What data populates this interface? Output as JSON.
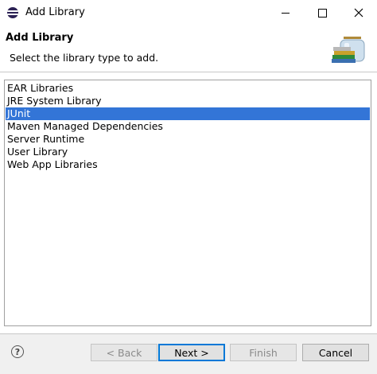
{
  "window": {
    "title": "Add Library"
  },
  "header": {
    "title": "Add Library",
    "description": "Select the library type to add."
  },
  "library_types": [
    {
      "label": "EAR Libraries",
      "selected": false
    },
    {
      "label": "JRE System Library",
      "selected": false
    },
    {
      "label": "JUnit",
      "selected": true
    },
    {
      "label": "Maven Managed Dependencies",
      "selected": false
    },
    {
      "label": "Server Runtime",
      "selected": false
    },
    {
      "label": "User Library",
      "selected": false
    },
    {
      "label": "Web App Libraries",
      "selected": false
    }
  ],
  "buttons": {
    "back": "< Back",
    "next": "Next >",
    "finish": "Finish",
    "cancel": "Cancel",
    "help": "?"
  },
  "icons": {
    "app": "eclipse-icon",
    "banner": "library-jar-icon",
    "help": "help-icon"
  },
  "colors": {
    "selection": "#3375d7",
    "default_button_border": "#0078d7"
  }
}
